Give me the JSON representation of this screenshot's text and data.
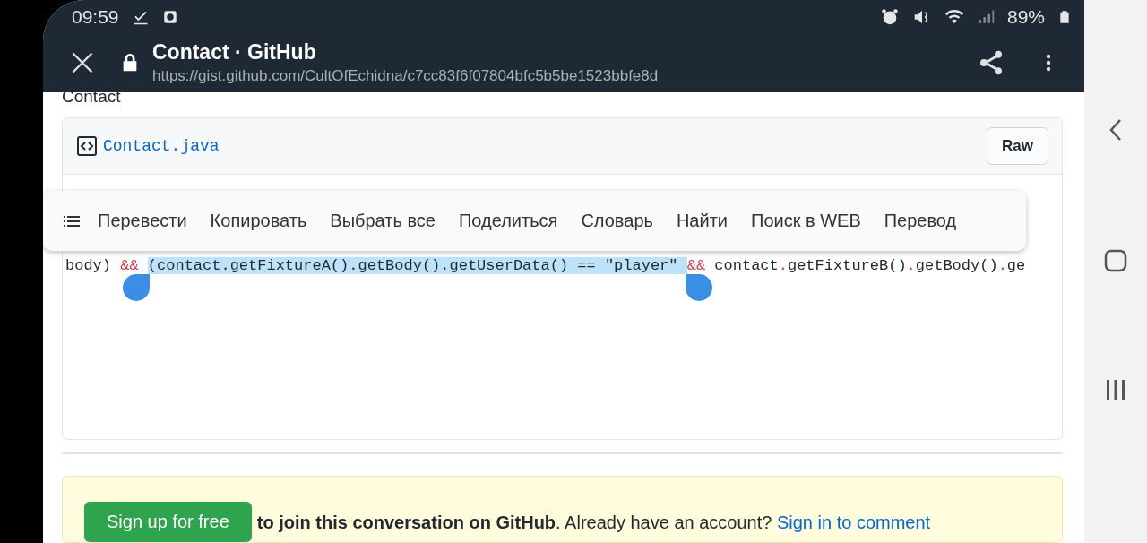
{
  "status_bar": {
    "time": "09:59",
    "battery": "89%"
  },
  "toolbar": {
    "title": "Contact · GitHub",
    "url": "https://gist.github.com/CultOfEchidna/c7cc83f6f07804bfc5b5be1523bbfe8d"
  },
  "page": {
    "heading": "Contact",
    "file": {
      "name": "Contact.java",
      "raw_button": "Raw"
    },
    "code_line": [
      {
        "text": "body) ",
        "kind": "plain",
        "selected": false
      },
      {
        "text": "&& ",
        "kind": "operator",
        "selected": false
      },
      {
        "text": "(contact.getFixtureA().getBody().getUserData() == \"player\" ",
        "kind": "plain",
        "selected": true
      },
      {
        "text": "&&",
        "kind": "operator",
        "selected": false
      },
      {
        "text": " contact",
        "kind": "plain",
        "selected": false
      },
      {
        "text": ".",
        "kind": "operator",
        "selected": false
      },
      {
        "text": "getFixtureB()",
        "kind": "plain",
        "selected": false
      },
      {
        "text": ".",
        "kind": "operator",
        "selected": false
      },
      {
        "text": "getBody()",
        "kind": "plain",
        "selected": false
      },
      {
        "text": ".",
        "kind": "operator",
        "selected": false
      },
      {
        "text": "ge",
        "kind": "plain",
        "selected": false
      }
    ]
  },
  "context_menu": {
    "items": [
      "Перевести",
      "Копировать",
      "Выбрать все",
      "Поделиться",
      "Словарь",
      "Найти",
      "Поиск в WEB",
      "Перевод"
    ]
  },
  "banner": {
    "button": "Sign up for free",
    "text": "**to join this conversation on GitHub**. Already have an account?",
    "link": "Sign in to comment"
  }
}
